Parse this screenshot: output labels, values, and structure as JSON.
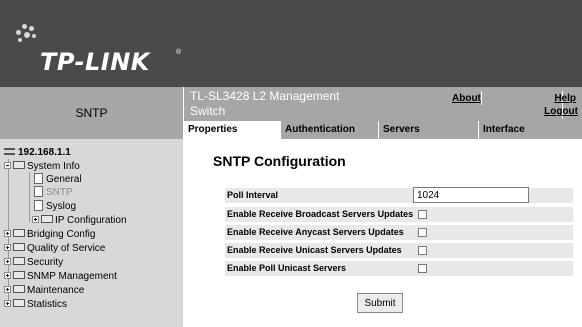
{
  "banner": {
    "logo_text": "TP-LINK",
    "registered_mark": "®"
  },
  "left_header": {
    "title": "SNTP"
  },
  "top_bar": {
    "device_name": "TL-SL3428 L2 Management Switch",
    "about": "About",
    "help": "Help",
    "logout": "Logout"
  },
  "tabs": [
    {
      "label": "Properties",
      "active": true
    },
    {
      "label": "Authentication",
      "active": false
    },
    {
      "label": "Servers",
      "active": false
    },
    {
      "label": "Interface",
      "active": false
    }
  ],
  "tree": {
    "root": "192.168.1.1",
    "items": [
      {
        "label": "System Info"
      },
      {
        "label": "General"
      },
      {
        "label": "SNTP",
        "selected": true
      },
      {
        "label": "Syslog"
      },
      {
        "label": "IP Configuration"
      },
      {
        "label": "Bridging Config"
      },
      {
        "label": "Quality of Service"
      },
      {
        "label": "Security"
      },
      {
        "label": "SNMP Management"
      },
      {
        "label": "Maintenance"
      },
      {
        "label": "Statistics"
      }
    ]
  },
  "main": {
    "title": "SNTP Configuration",
    "fields": {
      "poll_interval": {
        "label": "Poll Interval",
        "value": "1024"
      },
      "broadcast": {
        "label": "Enable Receive Broadcast Servers Updates",
        "checked": false
      },
      "anycast": {
        "label": "Enable Receive Anycast Servers Updates",
        "checked": false
      },
      "unicast": {
        "label": "Enable Receive Unicast Servers Updates",
        "checked": false
      },
      "poll_unicast": {
        "label": "Enable Poll Unicast Servers",
        "checked": false
      }
    },
    "submit": "Submit"
  },
  "colors": {
    "banner": "#4a4a4a",
    "bar": "#a6a6a6",
    "tree_bg": "#d8d8d8",
    "row_bg": "#e8e8e8"
  }
}
